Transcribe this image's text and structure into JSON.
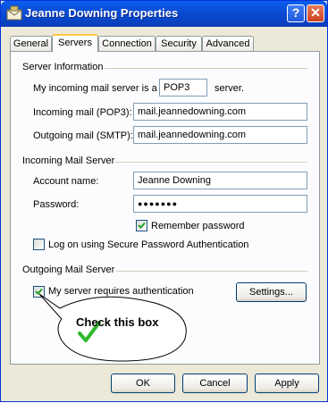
{
  "window": {
    "title": "Jeanne Downing Properties"
  },
  "titlebar": {
    "help": "?",
    "close": "✕"
  },
  "tabs": [
    {
      "label": "General"
    },
    {
      "label": "Servers"
    },
    {
      "label": "Connection"
    },
    {
      "label": "Security"
    },
    {
      "label": "Advanced"
    }
  ],
  "server_info": {
    "heading": "Server Information",
    "incoming_prefix": "My incoming mail server is a",
    "incoming_type": "POP3",
    "incoming_suffix": "server.",
    "pop3_label": "Incoming mail (POP3):",
    "pop3_value": "mail.jeannedowning.com",
    "smtp_label": "Outgoing mail (SMTP):",
    "smtp_value": "mail.jeannedowning.com"
  },
  "incoming_server": {
    "heading": "Incoming Mail Server",
    "account_label": "Account name:",
    "account_value": "Jeanne Downing",
    "password_label": "Password:",
    "password_value": "●●●●●●●",
    "remember_label": "Remember password",
    "remember_checked": true,
    "spa_label": "Log on using Secure Password Authentication",
    "spa_checked": false
  },
  "outgoing_server": {
    "heading": "Outgoing Mail Server",
    "auth_label": "My server requires authentication",
    "auth_checked": true,
    "settings_button": "Settings..."
  },
  "callout": {
    "text": "Check this box"
  },
  "buttons": {
    "ok": "OK",
    "cancel": "Cancel",
    "apply": "Apply"
  },
  "colors": {
    "titlebar": "#0A4DD6",
    "dialog_bg": "#ECE9D8",
    "check_mark": "#21A121",
    "tab_highlight": "#FFC83C"
  }
}
